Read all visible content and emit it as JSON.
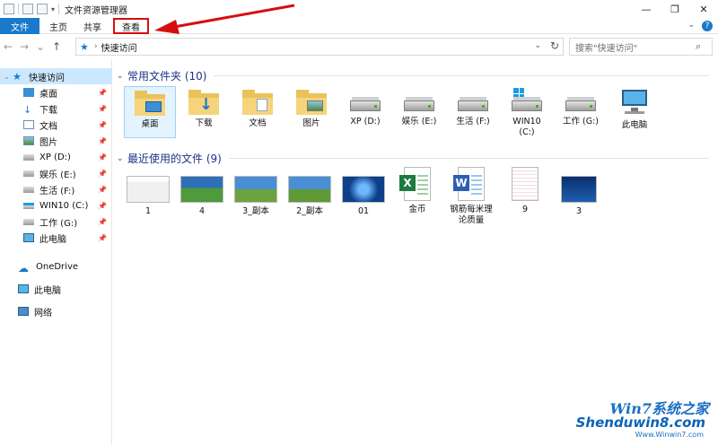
{
  "window": {
    "title": "文件资源管理器",
    "controls": {
      "minimize": "—",
      "maximize": "❐",
      "close": "✕"
    }
  },
  "ribbon": {
    "tabs": [
      "文件",
      "主页",
      "共享",
      "查看"
    ],
    "highlighted_tab": "查看",
    "expand": "⌄",
    "help": "?"
  },
  "address": {
    "back": "←",
    "forward": "→",
    "recent": "⌄",
    "up": "↑",
    "path": "快速访问",
    "dropdown": "⌄",
    "refresh": "↻"
  },
  "search": {
    "placeholder": "搜索\"快速访问\"",
    "icon": "search-icon"
  },
  "nav": {
    "quick_access": "快速访问",
    "items": [
      {
        "label": "桌面",
        "icon": "desktop-icon",
        "pinned": true
      },
      {
        "label": "下载",
        "icon": "download-icon",
        "pinned": true
      },
      {
        "label": "文档",
        "icon": "document-icon",
        "pinned": true
      },
      {
        "label": "图片",
        "icon": "picture-icon",
        "pinned": true
      },
      {
        "label": "XP (D:)",
        "icon": "drive-icon",
        "pinned": true
      },
      {
        "label": "娱乐 (E:)",
        "icon": "drive-icon",
        "pinned": true
      },
      {
        "label": "生活 (F:)",
        "icon": "drive-icon",
        "pinned": true
      },
      {
        "label": "WIN10 (C:)",
        "icon": "drive-icon",
        "pinned": true
      },
      {
        "label": "工作 (G:)",
        "icon": "drive-icon",
        "pinned": true
      },
      {
        "label": "此电脑",
        "icon": "computer-icon",
        "pinned": true
      }
    ],
    "onedrive": "OneDrive",
    "this_pc": "此电脑",
    "network": "网络"
  },
  "frequent": {
    "title": "常用文件夹 (10)",
    "items": [
      "桌面",
      "下载",
      "文档",
      "图片",
      "XP (D:)",
      "娱乐 (E:)",
      "生活 (F:)",
      "WIN10\n(C:)",
      "工作 (G:)",
      "此电脑"
    ]
  },
  "recent": {
    "title": "最近使用的文件 (9)",
    "items": [
      "1",
      "4",
      "3_副本",
      "2_副本",
      "01",
      "金币",
      "钢筋每米理\n论质量",
      "9",
      "3"
    ]
  },
  "watermark": {
    "brand": "Win7系统之家",
    "site": "Shenduwin8.com",
    "url": "Www.Winwin7.com"
  },
  "colors": {
    "accent": "#1979ca",
    "highlight_red": "#d50f0f",
    "section_title": "#1e3287"
  }
}
